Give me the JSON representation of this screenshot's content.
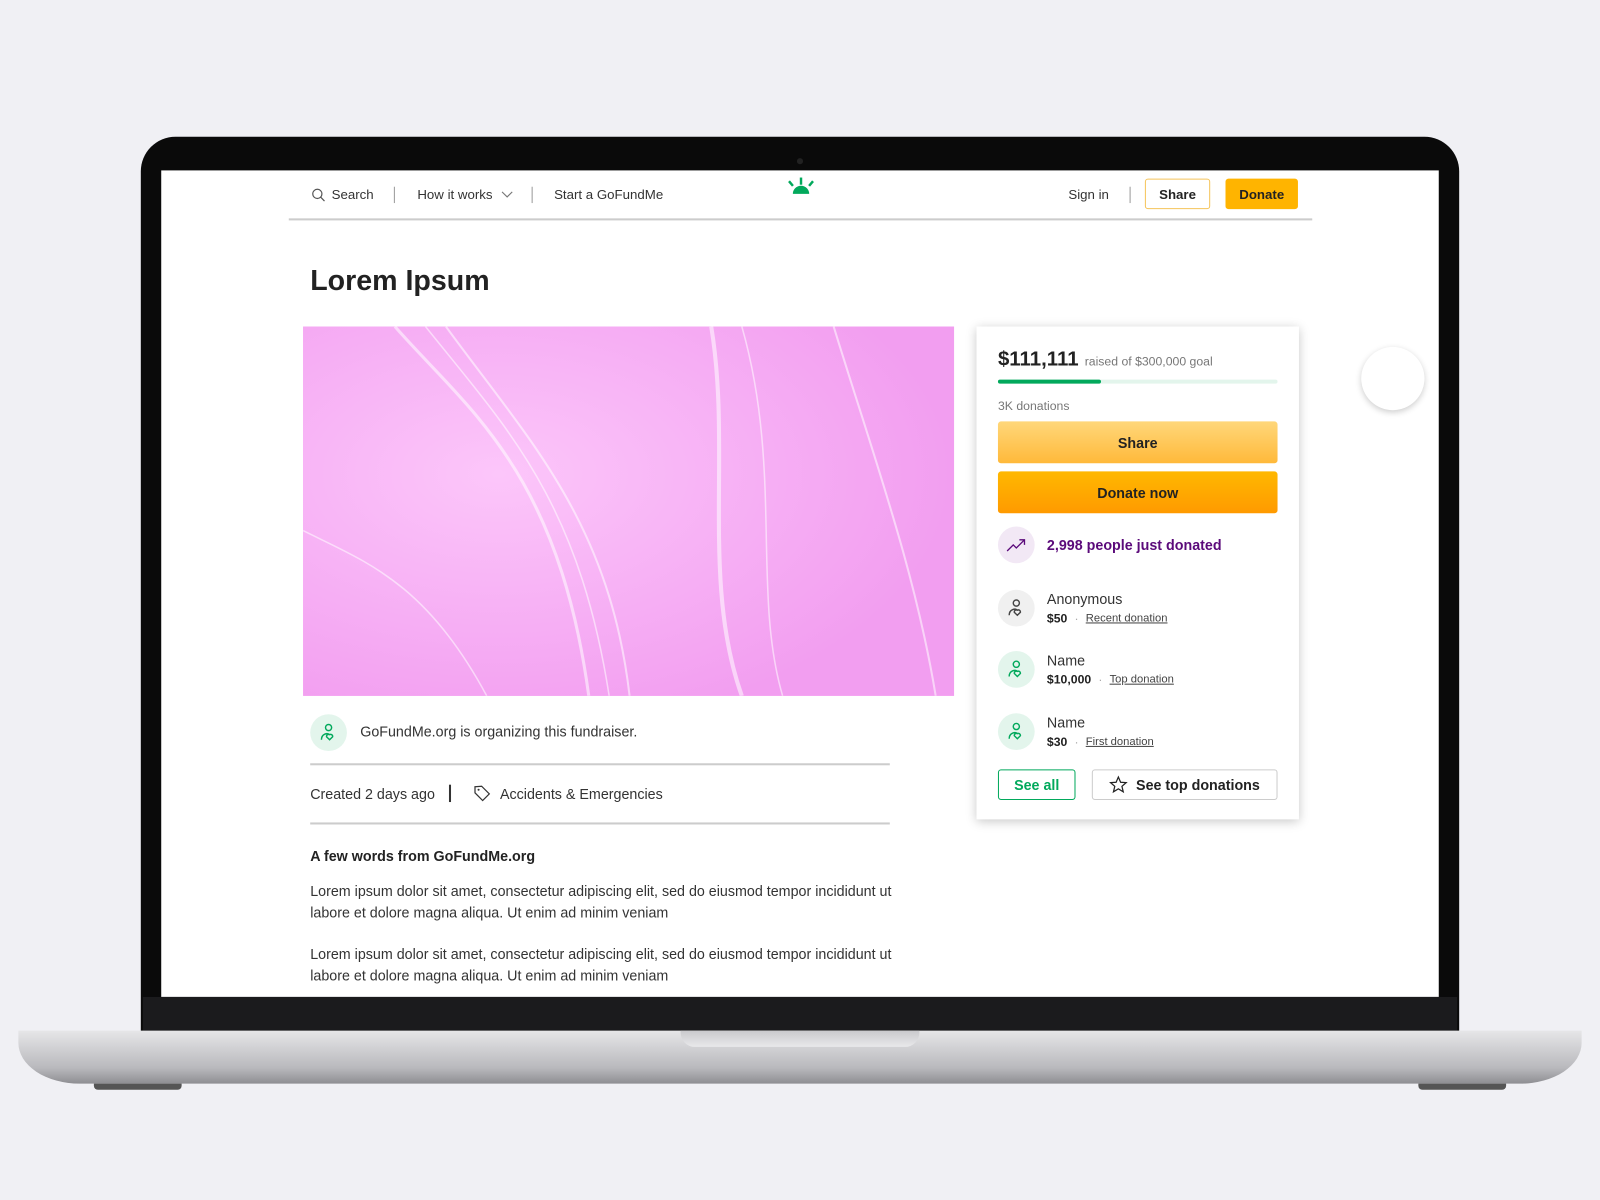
{
  "nav": {
    "search": "Search",
    "how_it_works": "How it works",
    "start": "Start a GoFundMe",
    "sign_in": "Sign in",
    "share": "Share",
    "donate": "Donate"
  },
  "campaign": {
    "title": "Lorem Ipsum",
    "organizer": "GoFundMe.org is organizing this fundraiser.",
    "created": "Created 2 days ago",
    "category": "Accidents & Emergencies",
    "story_heading": "A few words from GoFundMe.org",
    "paragraphs": [
      "Lorem ipsum dolor sit amet, consectetur adipiscing elit, sed do eiusmod tempor incididunt ut labore et dolore magna aliqua. Ut enim ad minim veniam",
      "Lorem ipsum dolor sit amet, consectetur adipiscing elit, sed do eiusmod tempor incididunt ut labore et dolore magna aliqua. Ut enim ad minim veniam"
    ]
  },
  "donation_card": {
    "raised": "$111,111",
    "goal_text": "raised of $300,000 goal",
    "progress_fraction": 0.37,
    "count": "3K donations",
    "share": "Share",
    "donate_now": "Donate now",
    "trend": "2,998 people just donated",
    "donations": [
      {
        "name": "Anonymous",
        "amount": "$50",
        "label": "Recent donation"
      },
      {
        "name": "Name",
        "amount": "$10,000",
        "label": "Top donation"
      },
      {
        "name": "Name",
        "amount": "$30",
        "label": "First donation"
      }
    ],
    "see_all": "See all",
    "see_top": "See top donations"
  },
  "colors": {
    "brand_green": "#02a95c",
    "donate_yellow": "#ffb400",
    "trend_purple": "#5b0a7a"
  }
}
